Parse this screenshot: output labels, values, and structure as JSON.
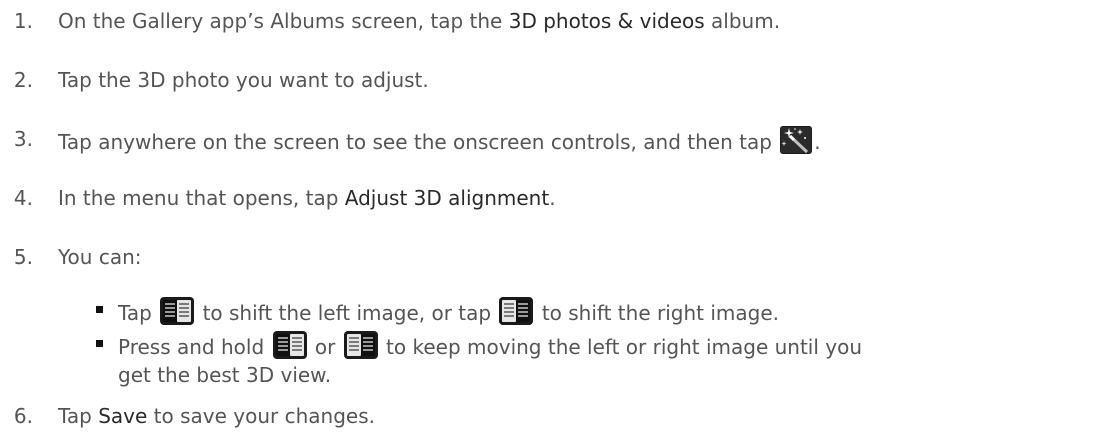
{
  "steps": [
    {
      "number": "1.",
      "pre": "On the Gallery app’s Albums screen, tap the ",
      "bold": "3D photos & videos",
      "post": " album."
    },
    {
      "number": "2.",
      "text": "Tap the 3D photo you want to adjust."
    },
    {
      "number": "3.",
      "pre": "Tap anywhere on the screen to see the onscreen controls, and then tap ",
      "icon": "magic-wand-icon",
      "post": "."
    },
    {
      "number": "4.",
      "pre": "In the menu that opens, tap ",
      "bold": "Adjust 3D alignment",
      "post": "."
    },
    {
      "number": "5.",
      "text": "You can:",
      "bullets": [
        {
          "a": "Tap ",
          "icon1": "shift-left-image-icon",
          "b": " to shift the left image, or tap ",
          "icon2": "shift-right-image-icon",
          "c": " to shift the right image."
        },
        {
          "a": "Press and hold ",
          "icon1": "shift-left-image-icon",
          "b": " or ",
          "icon2": "shift-right-image-icon",
          "c": " to keep moving the left or right image until you",
          "continuation": "get the best 3D view."
        }
      ]
    },
    {
      "number": "6.",
      "pre": "Tap ",
      "bold": "Save",
      "post": " to save your changes."
    }
  ],
  "colors": {
    "text": "#555555",
    "bold": "#2a2a2a",
    "icon_dark": "#1a1a1a",
    "icon_light": "#e8e8e8"
  }
}
